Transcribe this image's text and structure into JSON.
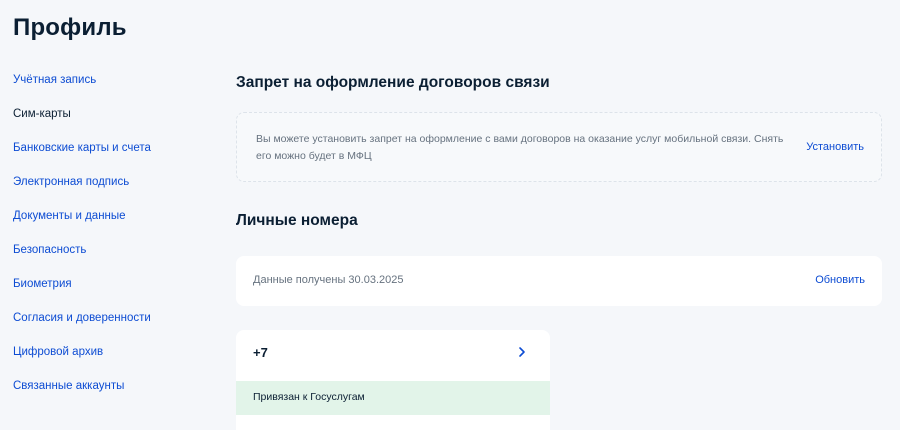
{
  "page": {
    "title": "Профиль"
  },
  "sidebar": {
    "items": [
      {
        "label": "Учётная запись"
      },
      {
        "label": "Сим-карты"
      },
      {
        "label": "Банковские карты и счета"
      },
      {
        "label": "Электронная подпись"
      },
      {
        "label": "Документы и данные"
      },
      {
        "label": "Безопасность"
      },
      {
        "label": "Биометрия"
      },
      {
        "label": "Согласия и доверенности"
      },
      {
        "label": "Цифровой архив"
      },
      {
        "label": "Связанные аккаунты"
      }
    ],
    "active_item": "Сим-карты"
  },
  "ban_section": {
    "title": "Запрет на оформление договоров связи",
    "text": "Вы можете установить запрет на оформление с вами договоров на оказание услуг мобильной связи. Снять его можно будет в МФЦ",
    "action_label": "Установить"
  },
  "numbers_section": {
    "title": "Личные номера",
    "data_status": "Данные получены 30.03.2025",
    "refresh_label": "Обновить",
    "phone": {
      "number": "+7",
      "status": "Привязан к Госуслугам"
    }
  },
  "colors": {
    "link": "#0d4cd3",
    "text": "#0b1f33",
    "muted": "#66727f",
    "background": "#f5f7fa",
    "linked_status_bg": "#e2f4e9"
  },
  "icons": {
    "phone_open": "chevron-right-icon"
  }
}
